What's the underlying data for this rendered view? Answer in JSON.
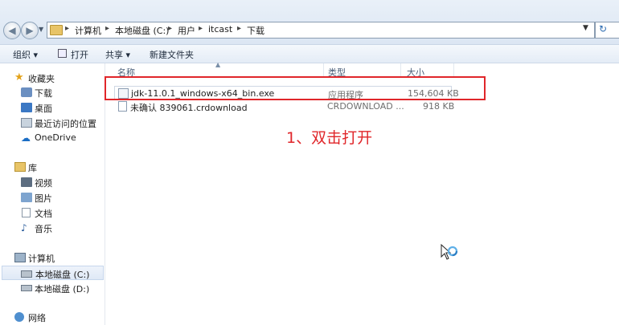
{
  "address": {
    "crumbs": [
      "计算机",
      "本地磁盘 (C:)",
      "用户",
      "itcast",
      "下载"
    ]
  },
  "toolbar": {
    "organize": "组织 ▾",
    "open": "打开",
    "share": "共享 ▾",
    "new_folder": "新建文件夹"
  },
  "nav": {
    "favorites": "收藏夹",
    "downloads": "下载",
    "desktop": "桌面",
    "recent": "最近访问的位置",
    "onedrive": "OneDrive",
    "library": "库",
    "videos": "视频",
    "pictures": "图片",
    "documents": "文档",
    "music": "音乐",
    "computer": "计算机",
    "drive_c": "本地磁盘 (C:)",
    "drive_d": "本地磁盘 (D:)",
    "network": "网络"
  },
  "columns": {
    "name": "名称",
    "type": "类型",
    "size": "大小"
  },
  "files": [
    {
      "name": "jdk-11.0.1_windows-x64_bin.exe",
      "type": "应用程序",
      "size": "154,604 KB"
    },
    {
      "name": "未确认 839061.crdownload",
      "type": "CRDOWNLOAD ...",
      "size": "918 KB"
    }
  ],
  "annotation": "1、双击打开",
  "colors": {
    "highlight": "#e0262a"
  }
}
